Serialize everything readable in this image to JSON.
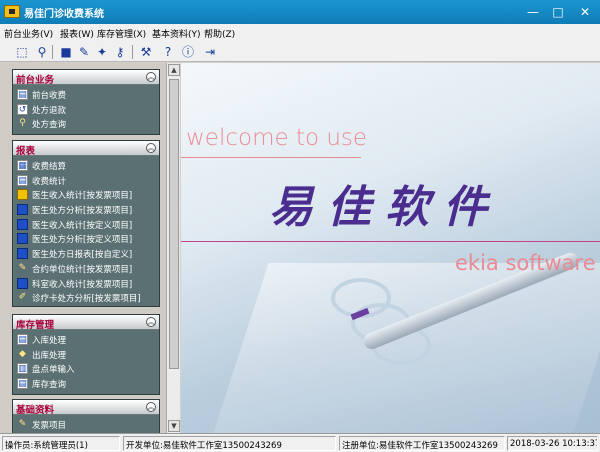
{
  "window": {
    "title": "易佳门诊收费系统",
    "min": "—",
    "max": "□",
    "close": "✕"
  },
  "menu": [
    "前台业务(V)",
    "报表(W)",
    "库存管理(X)",
    "基本资料(Y)",
    "帮助(Z)"
  ],
  "panels": [
    {
      "title": "前台业务",
      "items": [
        {
          "label": "前台收费",
          "icon": "document-icon"
        },
        {
          "label": "处方退款",
          "icon": "refund-icon"
        },
        {
          "label": "处方查询",
          "icon": "search-icon"
        }
      ]
    },
    {
      "title": "报表",
      "items": [
        {
          "label": "收费结算",
          "icon": "settle-icon"
        },
        {
          "label": "收费统计",
          "icon": "stats-icon"
        },
        {
          "label": "医生收入统计[按发票项目]",
          "icon": "report-icon"
        },
        {
          "label": "医生处方分析[按发票项目]",
          "icon": "report-icon"
        },
        {
          "label": "医生收入统计[按定义项目]",
          "icon": "report-icon"
        },
        {
          "label": "医生处方分析[按定义项目]",
          "icon": "report-icon"
        },
        {
          "label": "医生处方日报表[按自定义]",
          "icon": "report-icon"
        },
        {
          "label": "合约单位统计[按发票项目]",
          "icon": "contract-icon"
        },
        {
          "label": "科室收入统计[按发票项目]",
          "icon": "report-icon"
        },
        {
          "label": "诊疗卡处方分析[按发票项目]",
          "icon": "card-icon"
        }
      ]
    },
    {
      "title": "库存管理",
      "items": [
        {
          "label": "入库处理",
          "icon": "stock-in-icon"
        },
        {
          "label": "出库处理",
          "icon": "stock-out-icon"
        },
        {
          "label": "盘点单输入",
          "icon": "inventory-icon"
        },
        {
          "label": "库存查询",
          "icon": "stock-query-icon"
        }
      ]
    },
    {
      "title": "基础资料",
      "items": [
        {
          "label": "发票项目",
          "icon": "invoice-icon"
        }
      ]
    }
  ],
  "content": {
    "welcome": "welcome to use",
    "brand": "易佳软件",
    "tagline": "ekia software"
  },
  "status": {
    "operator": "操作员:系统管理员(1)",
    "developer": "开发单位:易佳软件工作室13500243269",
    "registered": "注册单位:易佳软件工作室13500243269",
    "datetime": "2018-03-26 10:13:37"
  }
}
